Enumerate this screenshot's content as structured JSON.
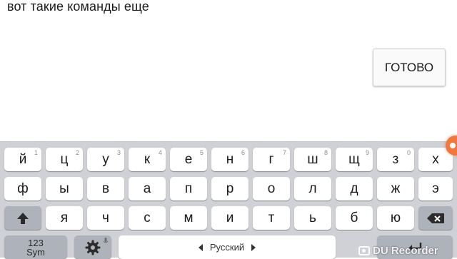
{
  "text_field": {
    "value": "вот такие команды еще"
  },
  "done_button": {
    "label": "ГОТОВО"
  },
  "keyboard": {
    "row1": [
      {
        "char": "й",
        "hint": "1"
      },
      {
        "char": "ц",
        "hint": "2"
      },
      {
        "char": "у",
        "hint": "3"
      },
      {
        "char": "к",
        "hint": "4"
      },
      {
        "char": "е",
        "hint": "5"
      },
      {
        "char": "н",
        "hint": "6"
      },
      {
        "char": "г",
        "hint": "7"
      },
      {
        "char": "ш",
        "hint": "8"
      },
      {
        "char": "щ",
        "hint": "9"
      },
      {
        "char": "з",
        "hint": "0"
      },
      {
        "char": "х",
        "hint": ""
      }
    ],
    "row2": [
      "ф",
      "ы",
      "в",
      "а",
      "п",
      "р",
      "о",
      "л",
      "д",
      "ж",
      "э"
    ],
    "row3": [
      "я",
      "ч",
      "с",
      "м",
      "и",
      "т",
      "ь",
      "б",
      "ю"
    ],
    "sym_label_top": "123",
    "sym_label_bottom": "Sym",
    "space_label": "Русский"
  },
  "watermark": {
    "text": "DU Recorder"
  },
  "colors": {
    "keyboard_bg": "#cfd1d6",
    "key_bg": "#ffffff",
    "modifier_bg": "#aeb3bb",
    "recorder_accent": "#f0783c"
  }
}
